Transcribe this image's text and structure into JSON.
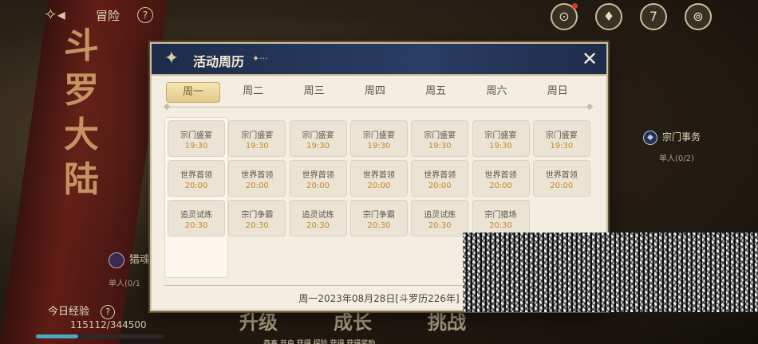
{
  "topbar": {
    "title": "冒险",
    "help": "?",
    "icons": [
      "mail-icon",
      "bell-settings-icon",
      "calendar-icon",
      "compass-icon"
    ],
    "calendar_day": "7"
  },
  "background": {
    "scroll_text": "斗罗大陆"
  },
  "side_task": {
    "label": "宗门事务",
    "sub": "单人(0/2)"
  },
  "hunt": {
    "label": "猎魂",
    "sub": "单人(0/1"
  },
  "exp": {
    "label": "今日经验",
    "help": "?",
    "value": "115112/344500",
    "progress": 0.334
  },
  "bottom_buttons": [
    "升级",
    "成长",
    "挑战"
  ],
  "ticker": "恭喜 开启 获得 探险 获得 获得奖励",
  "modal": {
    "title": "活动周历",
    "deco": "✦···",
    "close": "✕",
    "tabs": [
      "周一",
      "周二",
      "周三",
      "周四",
      "周五",
      "周六",
      "周日"
    ],
    "active_tab": 0,
    "columns": [
      [
        {
          "name": "宗门盛宴",
          "time": "19:30"
        },
        {
          "name": "世界首领",
          "time": "20:00"
        },
        {
          "name": "追灵试炼",
          "time": "20:30"
        }
      ],
      [
        {
          "name": "宗门盛宴",
          "time": "19:30"
        },
        {
          "name": "世界首领",
          "time": "20:00"
        },
        {
          "name": "宗门争霸",
          "time": "20:30"
        }
      ],
      [
        {
          "name": "宗门盛宴",
          "time": "19:30"
        },
        {
          "name": "世界首领",
          "time": "20:00"
        },
        {
          "name": "追灵试炼",
          "time": "20:30"
        }
      ],
      [
        {
          "name": "宗门盛宴",
          "time": "19:30"
        },
        {
          "name": "世界首领",
          "time": "20:00"
        },
        {
          "name": "宗门争霸",
          "time": "20:30"
        }
      ],
      [
        {
          "name": "宗门盛宴",
          "time": "19:30"
        },
        {
          "name": "世界首领",
          "time": "20:00"
        },
        {
          "name": "追灵试炼",
          "time": "20:30"
        }
      ],
      [
        {
          "name": "宗门盛宴",
          "time": "19:30"
        },
        {
          "name": "世界首领",
          "time": "20:00"
        },
        {
          "name": "宗门猎场",
          "time": "20:30"
        }
      ],
      [
        {
          "name": "宗门盛宴",
          "time": "19:30"
        },
        {
          "name": "世界首领",
          "time": "20:00"
        }
      ]
    ],
    "date_line": "周一2023年08月28日[斗罗历226年]"
  }
}
